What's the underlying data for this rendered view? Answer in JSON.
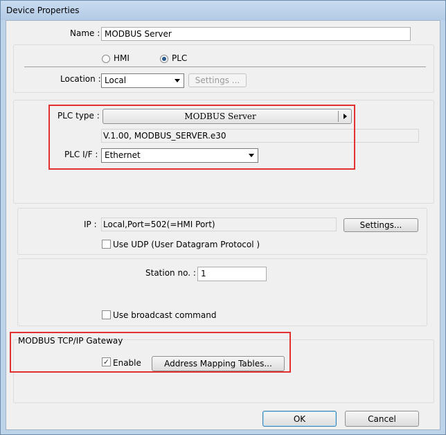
{
  "window": {
    "title": "Device Properties"
  },
  "name": {
    "label": "Name :",
    "value": "MODBUS Server"
  },
  "device_kind": {
    "options": [
      "HMI",
      "PLC"
    ],
    "selected": "PLC"
  },
  "location": {
    "label": "Location :",
    "value": "Local",
    "settings_label": "Settings ..."
  },
  "plc_type": {
    "label": "PLC type :",
    "value": "MODBUS Server",
    "version": "V.1.00, MODBUS_SERVER.e30"
  },
  "plc_if": {
    "label": "PLC I/F :",
    "value": "Ethernet"
  },
  "ip": {
    "label": "IP :",
    "value": "Local,Port=502(=HMI Port)",
    "settings_label": "Settings...",
    "udp_label": "Use UDP (User Datagram Protocol )",
    "udp_checked": false
  },
  "station": {
    "label": "Station no. :",
    "value": "1",
    "broadcast_label": "Use broadcast command",
    "broadcast_checked": false
  },
  "gateway": {
    "title": "MODBUS TCP/IP Gateway",
    "enable_label": "Enable",
    "enable_checked": true,
    "mapping_label": "Address Mapping Tables..."
  },
  "footer": {
    "ok_label": "OK",
    "cancel_label": "Cancel"
  },
  "colors": {
    "highlight_box": "#e03030",
    "radio_dot": "#2a5c8e"
  }
}
